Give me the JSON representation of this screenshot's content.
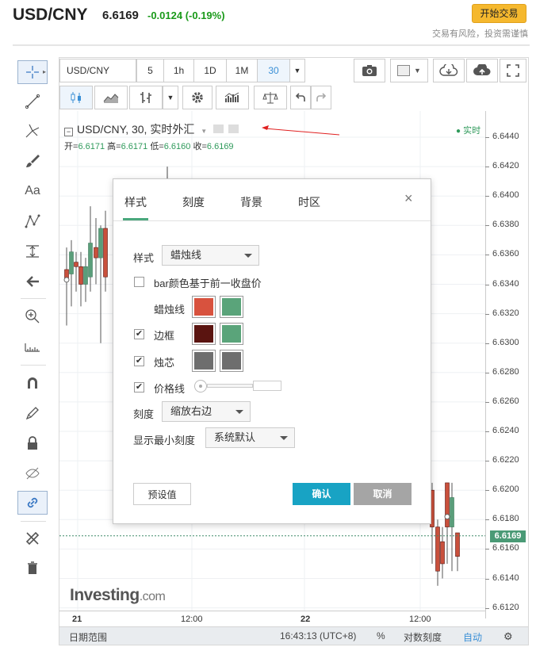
{
  "header": {
    "pair": "USD/CNY",
    "price": "6.6169",
    "change": "-0.0124 (-0.19%)",
    "trade_button": "开始交易",
    "risk_notice": "交易有风险，投资需谨慎"
  },
  "toolbar": {
    "symbol": "USD/CNY",
    "intervals": [
      "5",
      "1h",
      "1D",
      "1M",
      "30"
    ],
    "active_interval": "30"
  },
  "legend": {
    "title": "USD/CNY, 30, 实时外汇",
    "open_label": "开=",
    "open": "6.6171",
    "high_label": "高=",
    "high": "6.6171",
    "low_label": "低=",
    "low": "6.6160",
    "close_label": "收=",
    "close": "6.6169",
    "live": "实时"
  },
  "chart_data": {
    "type": "candlestick",
    "title": "",
    "ylim": [
      6.612,
      6.645
    ],
    "price_ticks": [
      "6.6440",
      "6.6420",
      "6.6400",
      "6.6380",
      "6.6360",
      "6.6340",
      "6.6320",
      "6.6300",
      "6.6280",
      "6.6260",
      "6.6240",
      "6.6220",
      "6.6200",
      "6.6180",
      "6.6160",
      "6.6140",
      "6.6120"
    ],
    "time_ticks": [
      "21",
      "12:00",
      "22",
      "12:00"
    ],
    "current_price": "6.6169",
    "up_color": "#5a9e7a",
    "down_color": "#c9503c",
    "candles": [
      {
        "o": 6.635,
        "h": 6.6365,
        "l": 6.6312,
        "c": 6.6343
      },
      {
        "o": 6.6347,
        "h": 6.637,
        "l": 6.6325,
        "c": 6.6362
      },
      {
        "o": 6.6355,
        "h": 6.6362,
        "l": 6.6335,
        "c": 6.6352
      },
      {
        "o": 6.6352,
        "h": 6.6362,
        "l": 6.6325,
        "c": 6.634
      },
      {
        "o": 6.634,
        "h": 6.6358,
        "l": 6.6328,
        "c": 6.6352
      },
      {
        "o": 6.6345,
        "h": 6.6393,
        "l": 6.6335,
        "c": 6.6368
      },
      {
        "o": 6.6365,
        "h": 6.6385,
        "l": 6.634,
        "c": 6.6358
      },
      {
        "o": 6.6358,
        "h": 6.638,
        "l": 6.63,
        "c": 6.6378
      },
      {
        "o": 6.6378,
        "h": 6.639,
        "l": 6.6335,
        "c": 6.6345
      },
      {
        "o": 6.62,
        "h": 6.6205,
        "l": 6.615,
        "c": 6.6175
      },
      {
        "o": 6.6175,
        "h": 6.618,
        "l": 6.6135,
        "c": 6.6145
      },
      {
        "o": 6.6165,
        "h": 6.6175,
        "l": 6.614,
        "c": 6.615
      },
      {
        "o": 6.6205,
        "h": 6.6205,
        "l": 6.615,
        "c": 6.6175
      },
      {
        "o": 6.6175,
        "h": 6.6205,
        "l": 6.6145,
        "c": 6.6195
      },
      {
        "o": 6.6171,
        "h": 6.6171,
        "l": 6.6145,
        "c": 6.6155
      }
    ]
  },
  "dialog": {
    "tabs": [
      "样式",
      "刻度",
      "背景",
      "时区"
    ],
    "style_label": "样式",
    "style_value": "蜡烛线",
    "bar_color_label": "bar颜色基于前一收盘价",
    "candle_label": "蜡烛线",
    "border_label": "边框",
    "wick_label": "烛芯",
    "price_line_label": "价格线",
    "scale_label": "刻度",
    "scale_value": "缩放右边",
    "min_tick_label": "显示最小刻度",
    "min_tick_value": "系统默认",
    "preset_button": "预设值",
    "ok_button": "确认",
    "cancel_button": "取消",
    "colors": {
      "candle_down": "#d8523e",
      "candle_up": "#5aa47a",
      "border_down": "#5a1410",
      "border_up": "#5aa47a",
      "wick_down": "#6e6e6e",
      "wick_up": "#6e6e6e"
    }
  },
  "bottom": {
    "date_range": "日期范围",
    "time": "16:43:13 (UTC+8)",
    "percent": "%",
    "log_scale": "对数刻度",
    "auto": "自动"
  },
  "watermark": {
    "brand": "Investing",
    "suffix": ".com"
  }
}
